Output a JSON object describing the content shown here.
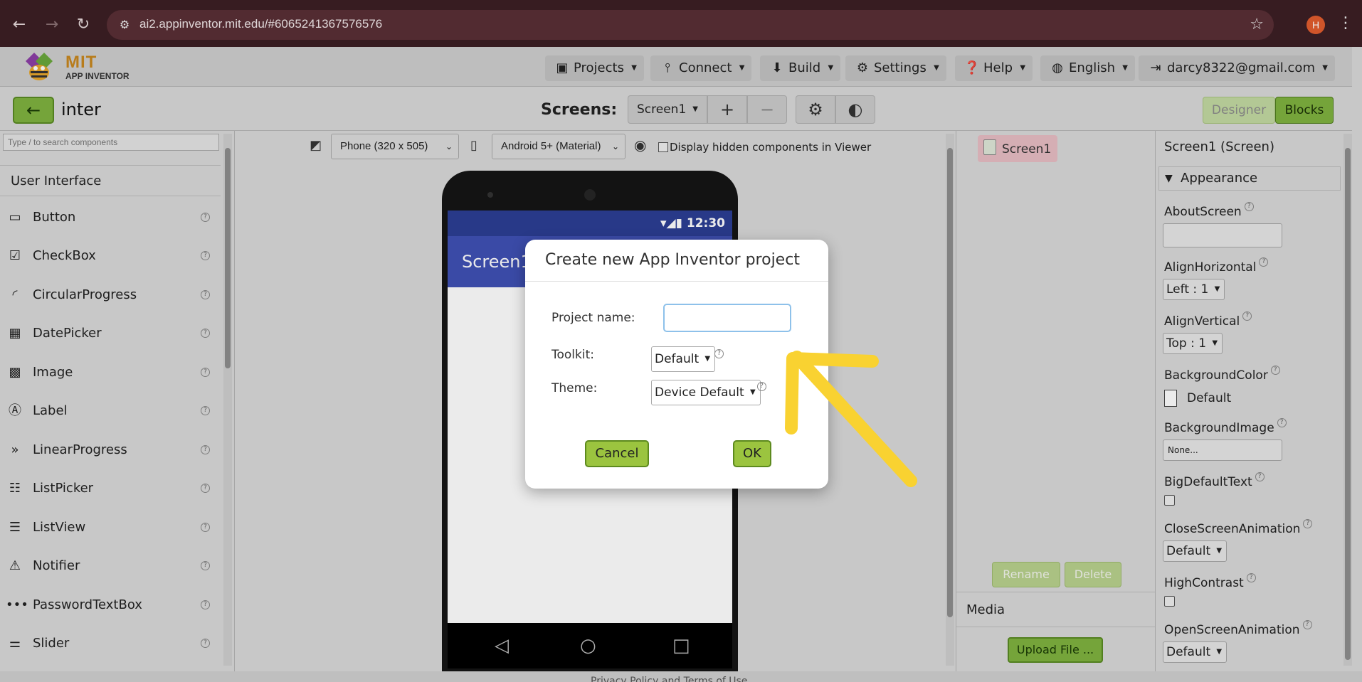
{
  "browser": {
    "url": "ai2.appinventor.mit.edu/#6065241367576576",
    "profile_initial": "H"
  },
  "appbar": {
    "logo_top": "MIT",
    "logo_bottom": "APP INVENTOR",
    "menus": [
      {
        "label": "Projects",
        "icon": "archive-icon"
      },
      {
        "label": "Connect",
        "icon": "signal-icon"
      },
      {
        "label": "Build",
        "icon": "download-icon"
      },
      {
        "label": "Settings",
        "icon": "gear-icon"
      },
      {
        "label": "Help",
        "icon": "question-icon"
      },
      {
        "label": "English",
        "icon": "globe-icon"
      },
      {
        "label": "darcy8322@gmail.com",
        "icon": "logout-icon"
      }
    ]
  },
  "toolbar": {
    "project_name": "inter",
    "screens_label": "Screens:",
    "screen_selected": "Screen1",
    "add_label": "+",
    "remove_label": "−",
    "designer_label": "Designer",
    "blocks_label": "Blocks"
  },
  "palette": {
    "search_placeholder": "Type / to search components",
    "category": "User Interface",
    "components": [
      {
        "label": "Button",
        "icon": "button-icon"
      },
      {
        "label": "CheckBox",
        "icon": "checkbox-icon"
      },
      {
        "label": "CircularProgress",
        "icon": "circular-progress-icon"
      },
      {
        "label": "DatePicker",
        "icon": "calendar-icon"
      },
      {
        "label": "Image",
        "icon": "image-icon"
      },
      {
        "label": "Label",
        "icon": "label-icon"
      },
      {
        "label": "LinearProgress",
        "icon": "double-chevron-icon"
      },
      {
        "label": "ListPicker",
        "icon": "list-picker-icon"
      },
      {
        "label": "ListView",
        "icon": "list-view-icon"
      },
      {
        "label": "Notifier",
        "icon": "warning-icon"
      },
      {
        "label": "PasswordTextBox",
        "icon": "password-icon"
      },
      {
        "label": "Slider",
        "icon": "slider-icon"
      }
    ]
  },
  "viewer": {
    "size_option": "Phone (320 x 505)",
    "theme_option": "Android 5+ (Material)",
    "hidden_components_label": "Display hidden components in Viewer",
    "phone_time": "12:30",
    "phone_title": "Screen1"
  },
  "tree": {
    "root": "Screen1",
    "rename_label": "Rename",
    "delete_label": "Delete",
    "media_label": "Media",
    "upload_label": "Upload File ..."
  },
  "properties": {
    "title": "Screen1 (Screen)",
    "section": "Appearance",
    "about_screen": "AboutScreen",
    "align_horizontal": "AlignHorizontal",
    "align_horizontal_value": "Left : 1",
    "align_vertical": "AlignVertical",
    "align_vertical_value": "Top : 1",
    "background_color": "BackgroundColor",
    "background_color_value": "Default",
    "background_image": "BackgroundImage",
    "background_image_value": "None...",
    "big_default_text": "BigDefaultText",
    "close_screen_animation": "CloseScreenAnimation",
    "close_screen_animation_value": "Default",
    "high_contrast": "HighContrast",
    "open_screen_animation": "OpenScreenAnimation",
    "open_screen_animation_value": "Default"
  },
  "footer": {
    "text": "Privacy Policy and Terms of Use"
  },
  "dialog": {
    "title": "Create new App Inventor project",
    "project_name_label": "Project name:",
    "project_name_value": "",
    "toolkit_label": "Toolkit:",
    "toolkit_value": "Default",
    "theme_label": "Theme:",
    "theme_value": "Device Default",
    "cancel_label": "Cancel",
    "ok_label": "OK"
  },
  "colors": {
    "accent_green": "#7fb23f",
    "phone_header": "#3f51b5",
    "annotation_arrow": "#f9d231"
  }
}
